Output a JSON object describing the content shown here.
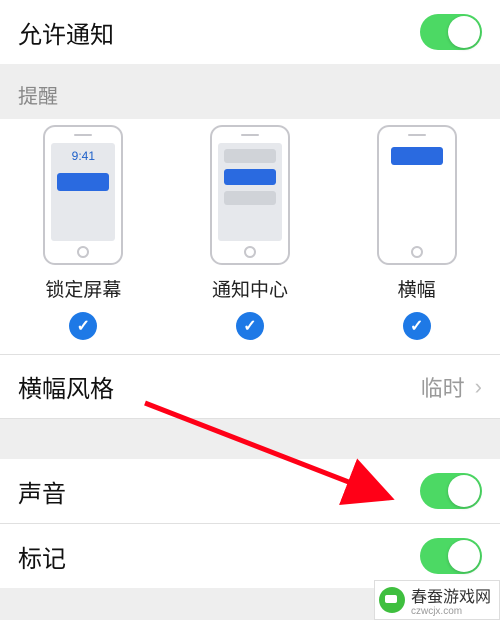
{
  "allow_notifications": {
    "label": "允许通知",
    "on": true
  },
  "alerts_section": {
    "header": "提醒",
    "lock": {
      "label": "锁定屏幕",
      "time": "9:41",
      "checked": true
    },
    "nc": {
      "label": "通知中心",
      "checked": true
    },
    "banner": {
      "label": "横幅",
      "checked": true
    }
  },
  "banner_style": {
    "label": "横幅风格",
    "value": "临时"
  },
  "sounds": {
    "label": "声音",
    "on": true
  },
  "badges": {
    "label": "标记",
    "on": true
  },
  "watermark": {
    "name": "春蚕游戏网",
    "url": "czwcjx.com"
  },
  "annotation_arrow": {
    "color": "#ff0017"
  }
}
